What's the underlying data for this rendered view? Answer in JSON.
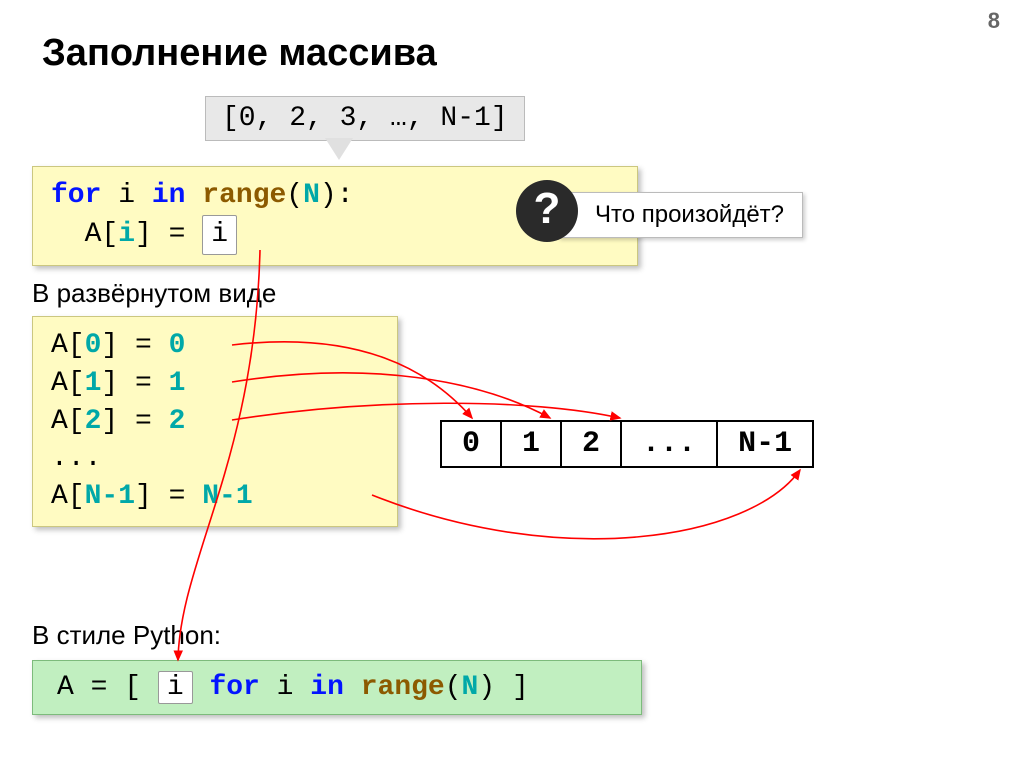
{
  "page_number": "8",
  "title": "Заполнение массива",
  "range_expr": "[0, 2, 3, …, N-1]",
  "code1": {
    "kw_for": "for",
    "var_i": "i",
    "kw_in": "in",
    "fn_range": "range",
    "paren_open": "(",
    "arg_n": "N",
    "close": "):",
    "line2_prefix": "A[",
    "line2_idx": "i",
    "line2_mid": "] = ",
    "line2_pill": "i"
  },
  "question": {
    "mark": "?",
    "text": "Что произойдёт?"
  },
  "subtitle1": "В развёрнутом виде",
  "code2": {
    "l1a": "A[",
    "l1i": "0",
    "l1b": "] = ",
    "l1v": "0",
    "l2a": "A[",
    "l2i": "1",
    "l2b": "] = ",
    "l2v": "1",
    "l3a": "A[",
    "l3i": "2",
    "l3b": "] = ",
    "l3v": "2",
    "l4": "...",
    "l5a": "A[",
    "l5i": "N-1",
    "l5b": "] = ",
    "l5v": "N-1"
  },
  "table": [
    "0",
    "1",
    "2",
    "...",
    "N-1"
  ],
  "subtitle2": "В стиле Python:",
  "code3": {
    "pre": "A = [ ",
    "pill": "i",
    "mid": " ",
    "kw_for": "for",
    "var_i": " i ",
    "kw_in": "in",
    "sp": " ",
    "fn_range": "range",
    "paren_open": "(",
    "arg_n": "N",
    "close": ") ]"
  }
}
